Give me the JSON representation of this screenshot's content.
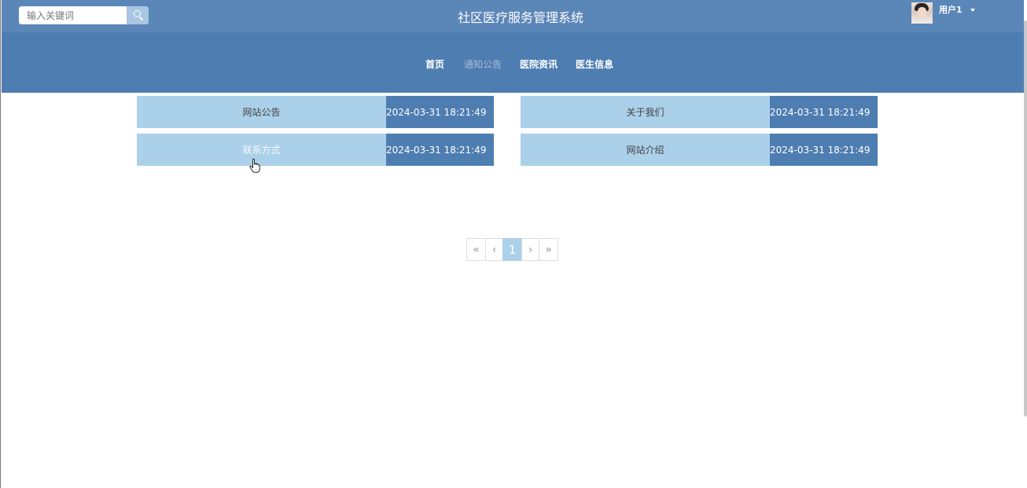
{
  "header": {
    "site_title": "社区医疗服务管理系统",
    "search": {
      "placeholder": "输入关键词",
      "value": "",
      "button_icon": "search-icon"
    },
    "user": {
      "name": "用户1",
      "avatar": "avatar-image",
      "menu_icon": "caret-down-icon"
    }
  },
  "nav": {
    "items": [
      {
        "label": "首页"
      },
      {
        "label": "通知公告",
        "active": true
      },
      {
        "label": "医院资讯"
      },
      {
        "label": "医生信息"
      }
    ]
  },
  "notices": [
    {
      "title": "网站公告",
      "date": "2024-03-31 18:21:49"
    },
    {
      "title": "关于我们",
      "date": "2024-03-31 18:21:49"
    },
    {
      "title": "联系方式",
      "date": "2024-03-31 18:21:49"
    },
    {
      "title": "网站介绍",
      "date": "2024-03-31 18:21:49"
    }
  ],
  "pagination": {
    "first": "«",
    "prev": "‹",
    "current": "1",
    "next": "›",
    "last": "»"
  },
  "colors": {
    "header": "#4e7db1",
    "topbar": "#5b86b8",
    "tile_light": "#abd0ea",
    "tile_dark": "#4e7db1",
    "active_nav": "#a9bcd4"
  }
}
